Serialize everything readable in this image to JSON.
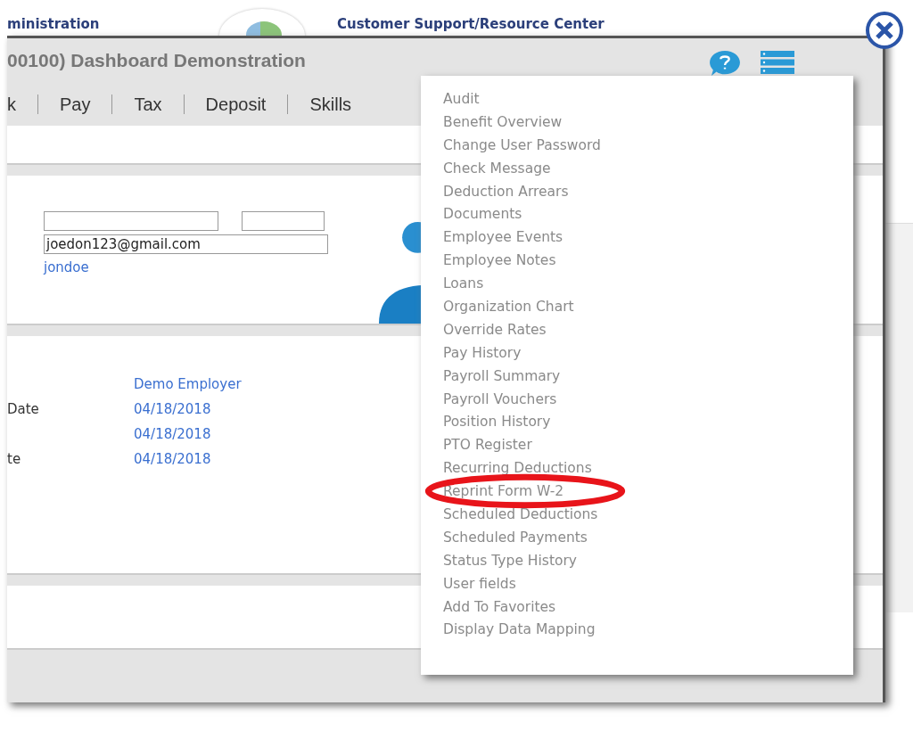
{
  "page_header": {
    "left_title": "ministration",
    "right_title": "Customer Support/Resource Center"
  },
  "dialog": {
    "title": "00100) Dashboard Demonstration",
    "tabs": [
      "k",
      "Pay",
      "Tax",
      "Deposit",
      "Skills"
    ],
    "profile": {
      "email": "joedon123@gmail.com",
      "username": "jondoe"
    },
    "details": [
      {
        "value": "Demo Employer"
      },
      {
        "label": "Date",
        "value": "04/18/2018"
      },
      {
        "value": "04/18/2018"
      },
      {
        "label": "te",
        "value": "04/18/2018"
      }
    ]
  },
  "menu": {
    "items": [
      {
        "label": "Audit",
        "circled": false
      },
      {
        "label": "Benefit Overview",
        "circled": false
      },
      {
        "label": "Change User Password",
        "circled": false
      },
      {
        "label": "Check Message",
        "circled": false
      },
      {
        "label": "Deduction Arrears",
        "circled": false
      },
      {
        "label": "Documents",
        "circled": false
      },
      {
        "label": "Employee Events",
        "circled": false
      },
      {
        "label": "Employee Notes",
        "circled": false
      },
      {
        "label": "Loans",
        "circled": false
      },
      {
        "label": "Organization Chart",
        "circled": false
      },
      {
        "label": "Override Rates",
        "circled": false
      },
      {
        "label": "Pay History",
        "circled": false
      },
      {
        "label": "Payroll Summary",
        "circled": false
      },
      {
        "label": "Payroll Vouchers",
        "circled": false
      },
      {
        "label": "Position History",
        "circled": false
      },
      {
        "label": "PTO Register",
        "circled": false
      },
      {
        "label": "Recurring Deductions",
        "circled": false
      },
      {
        "label": "Reprint Form W-2",
        "circled": true
      },
      {
        "label": "Scheduled Deductions",
        "circled": false
      },
      {
        "label": "Scheduled Payments",
        "circled": false
      },
      {
        "label": "Status Type History",
        "circled": false
      },
      {
        "label": "User fields",
        "circled": false
      },
      {
        "label": "Add To Favorites",
        "circled": false
      },
      {
        "label": "Display Data Mapping",
        "circled": false
      }
    ]
  }
}
